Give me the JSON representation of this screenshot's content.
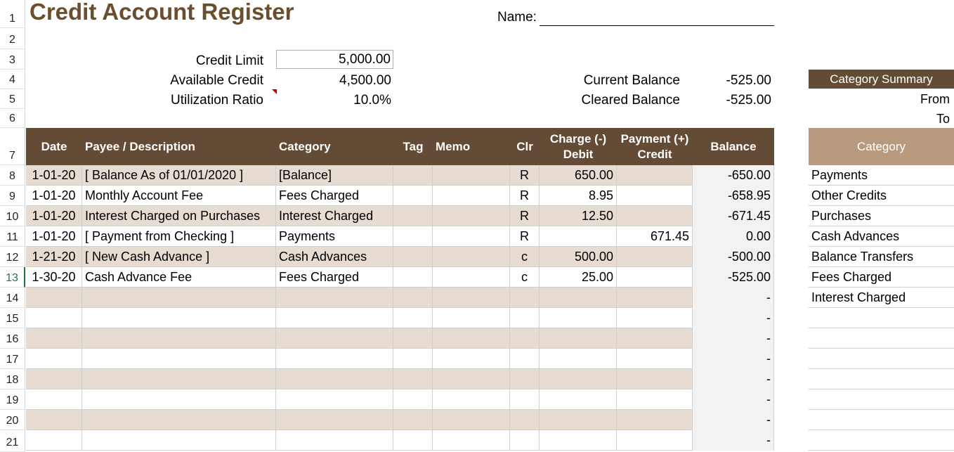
{
  "title": "Credit Account Register",
  "name_label": "Name:",
  "row_numbers": [
    "1",
    "2",
    "3",
    "4",
    "5",
    "6",
    "7",
    "8",
    "9",
    "10",
    "11",
    "12",
    "13",
    "14",
    "15",
    "16",
    "17",
    "18",
    "19",
    "20",
    "21"
  ],
  "summary_left": {
    "credit_limit_label": "Credit Limit",
    "credit_limit": "5,000.00",
    "available_credit_label": "Available Credit",
    "available_credit": "4,500.00",
    "utilization_label": "Utilization Ratio",
    "utilization": "10.0%"
  },
  "summary_right": {
    "current_balance_label": "Current Balance",
    "current_balance": "-525.00",
    "cleared_balance_label": "Cleared Balance",
    "cleared_balance": "-525.00"
  },
  "columns": {
    "date": "Date",
    "payee": "Payee / Description",
    "category": "Category",
    "tag": "Tag",
    "memo": "Memo",
    "clr": "Clr",
    "charge_l1": "Charge (-)",
    "charge_l2": "Debit",
    "payment_l1": "Payment (+)",
    "payment_l2": "Credit",
    "balance": "Balance"
  },
  "rows": [
    {
      "date": "1-01-20",
      "payee": "[ Balance As of 01/01/2020 ]",
      "category": "[Balance]",
      "tag": "",
      "memo": "",
      "clr": "R",
      "charge": "650.00",
      "payment": "",
      "balance": "-650.00"
    },
    {
      "date": "1-01-20",
      "payee": "Monthly Account Fee",
      "category": "Fees Charged",
      "tag": "",
      "memo": "",
      "clr": "R",
      "charge": "8.95",
      "payment": "",
      "balance": "-658.95"
    },
    {
      "date": "1-01-20",
      "payee": "Interest Charged on Purchases",
      "category": "Interest Charged",
      "tag": "",
      "memo": "",
      "clr": "R",
      "charge": "12.50",
      "payment": "",
      "balance": "-671.45"
    },
    {
      "date": "1-01-20",
      "payee": "[ Payment from Checking ]",
      "category": "Payments",
      "tag": "",
      "memo": "",
      "clr": "R",
      "charge": "",
      "payment": "671.45",
      "balance": "0.00"
    },
    {
      "date": "1-21-20",
      "payee": "[ New Cash Advance ]",
      "category": "Cash Advances",
      "tag": "",
      "memo": "",
      "clr": "c",
      "charge": "500.00",
      "payment": "",
      "balance": "-500.00"
    },
    {
      "date": "1-30-20",
      "payee": "Cash Advance Fee",
      "category": "Fees Charged",
      "tag": "",
      "memo": "",
      "clr": "c",
      "charge": "25.00",
      "payment": "",
      "balance": "-525.00"
    },
    {
      "date": "",
      "payee": "",
      "category": "",
      "tag": "",
      "memo": "",
      "clr": "",
      "charge": "",
      "payment": "",
      "balance": "-"
    },
    {
      "date": "",
      "payee": "",
      "category": "",
      "tag": "",
      "memo": "",
      "clr": "",
      "charge": "",
      "payment": "",
      "balance": "-"
    },
    {
      "date": "",
      "payee": "",
      "category": "",
      "tag": "",
      "memo": "",
      "clr": "",
      "charge": "",
      "payment": "",
      "balance": "-"
    },
    {
      "date": "",
      "payee": "",
      "category": "",
      "tag": "",
      "memo": "",
      "clr": "",
      "charge": "",
      "payment": "",
      "balance": "-"
    },
    {
      "date": "",
      "payee": "",
      "category": "",
      "tag": "",
      "memo": "",
      "clr": "",
      "charge": "",
      "payment": "",
      "balance": "-"
    },
    {
      "date": "",
      "payee": "",
      "category": "",
      "tag": "",
      "memo": "",
      "clr": "",
      "charge": "",
      "payment": "",
      "balance": "-"
    },
    {
      "date": "",
      "payee": "",
      "category": "",
      "tag": "",
      "memo": "",
      "clr": "",
      "charge": "",
      "payment": "",
      "balance": "-"
    },
    {
      "date": "",
      "payee": "",
      "category": "",
      "tag": "",
      "memo": "",
      "clr": "",
      "charge": "",
      "payment": "",
      "balance": "-"
    }
  ],
  "category_summary": {
    "title": "Category Summary",
    "from_label": "From",
    "to_label": "To",
    "header": "Category",
    "items": [
      "Payments",
      "Other Credits",
      "Purchases",
      "Cash Advances",
      "Balance Transfers",
      "Fees Charged",
      "Interest Charged",
      "",
      "",
      "",
      "",
      "",
      "",
      ""
    ]
  }
}
